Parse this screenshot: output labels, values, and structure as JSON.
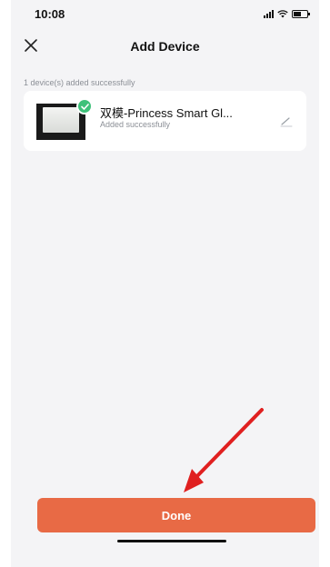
{
  "status_bar": {
    "time": "10:08",
    "signal_icon": "cellular-signal-icon",
    "wifi_icon": "wifi-icon",
    "battery_icon": "battery-icon",
    "battery_level": 0.6
  },
  "header": {
    "title": "Add Device",
    "close_icon": "close-icon"
  },
  "section_label": "1 device(s) added successfully",
  "device": {
    "name": "双模-Princess Smart Gl...",
    "status": "Added successfully",
    "badge_icon": "check-circle-icon",
    "edit_icon": "edit-pencil-icon",
    "badge_color": "#3fc17a"
  },
  "done_button": {
    "label": "Done",
    "color": "#e86a45"
  },
  "annotation": {
    "icon": "red-arrow-icon",
    "color": "#e02020"
  }
}
